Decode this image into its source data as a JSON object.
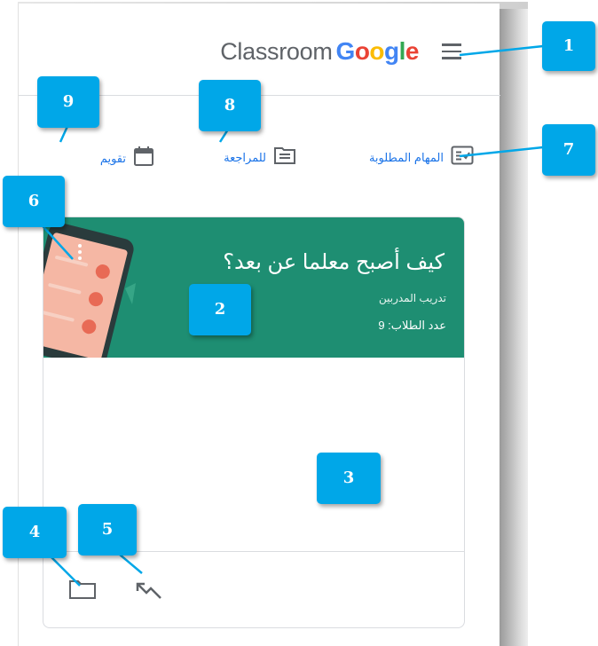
{
  "header": {
    "brand_word": "Classroom",
    "brand_google": [
      "G",
      "o",
      "o",
      "g",
      "l",
      "e"
    ]
  },
  "nav": {
    "todo_label": "المهام المطلوبة",
    "review_label": "للمراجعة",
    "calendar_label": "تقويم"
  },
  "card": {
    "title": "كيف أصبح معلما عن بعد؟",
    "section": "تدريب المدربين",
    "students": "عدد الطلاب: 9"
  },
  "callouts": [
    "1",
    "2",
    "3",
    "4",
    "5",
    "6",
    "7",
    "8",
    "9"
  ],
  "colors": {
    "banner": "#1e8e72",
    "callout": "#00a7e8",
    "link": "#1a73e8"
  },
  "icons": {
    "menu": "hamburger-icon",
    "todo": "assignment-check-icon",
    "review": "review-list-icon",
    "calendar": "calendar-icon",
    "folder": "folder-icon",
    "trend": "trending-icon"
  }
}
